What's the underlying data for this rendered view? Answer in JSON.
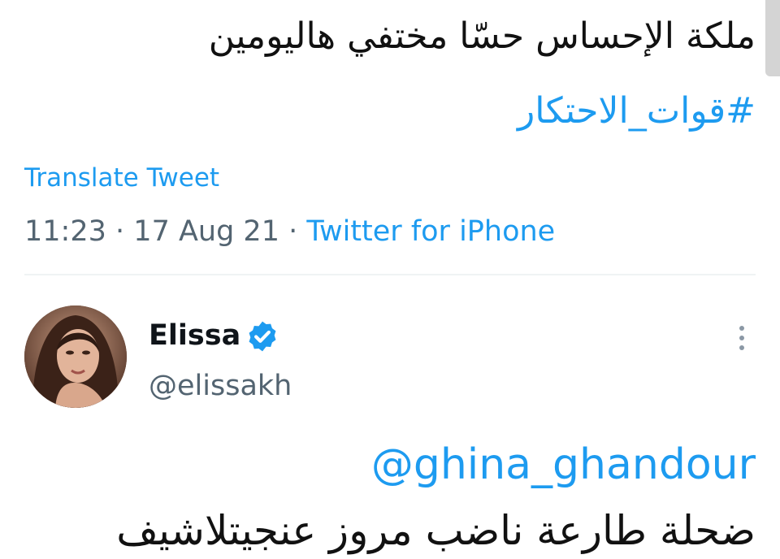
{
  "tweet": {
    "text": "ملكة الإحساس حسّا مختفي هاليومين",
    "hashtag": "#قوات_الاحتكار",
    "translate_label": "Translate Tweet",
    "time": "11:23",
    "date": "17 Aug 21",
    "separator": "·",
    "source": "Twitter for iPhone"
  },
  "reply": {
    "display_name": "Elissa",
    "handle": "@elissakh",
    "verified": true,
    "mention": "@ghina_ghandour",
    "text": "ضحلة طارعة ناضب مروز عنجيتلاشيف",
    "icons": {
      "verified": "verified-badge-icon",
      "more": "more-vertical-icon"
    }
  },
  "colors": {
    "accent": "#1d9bf0",
    "secondary_text": "#536471",
    "divider": "#eff3f4"
  }
}
